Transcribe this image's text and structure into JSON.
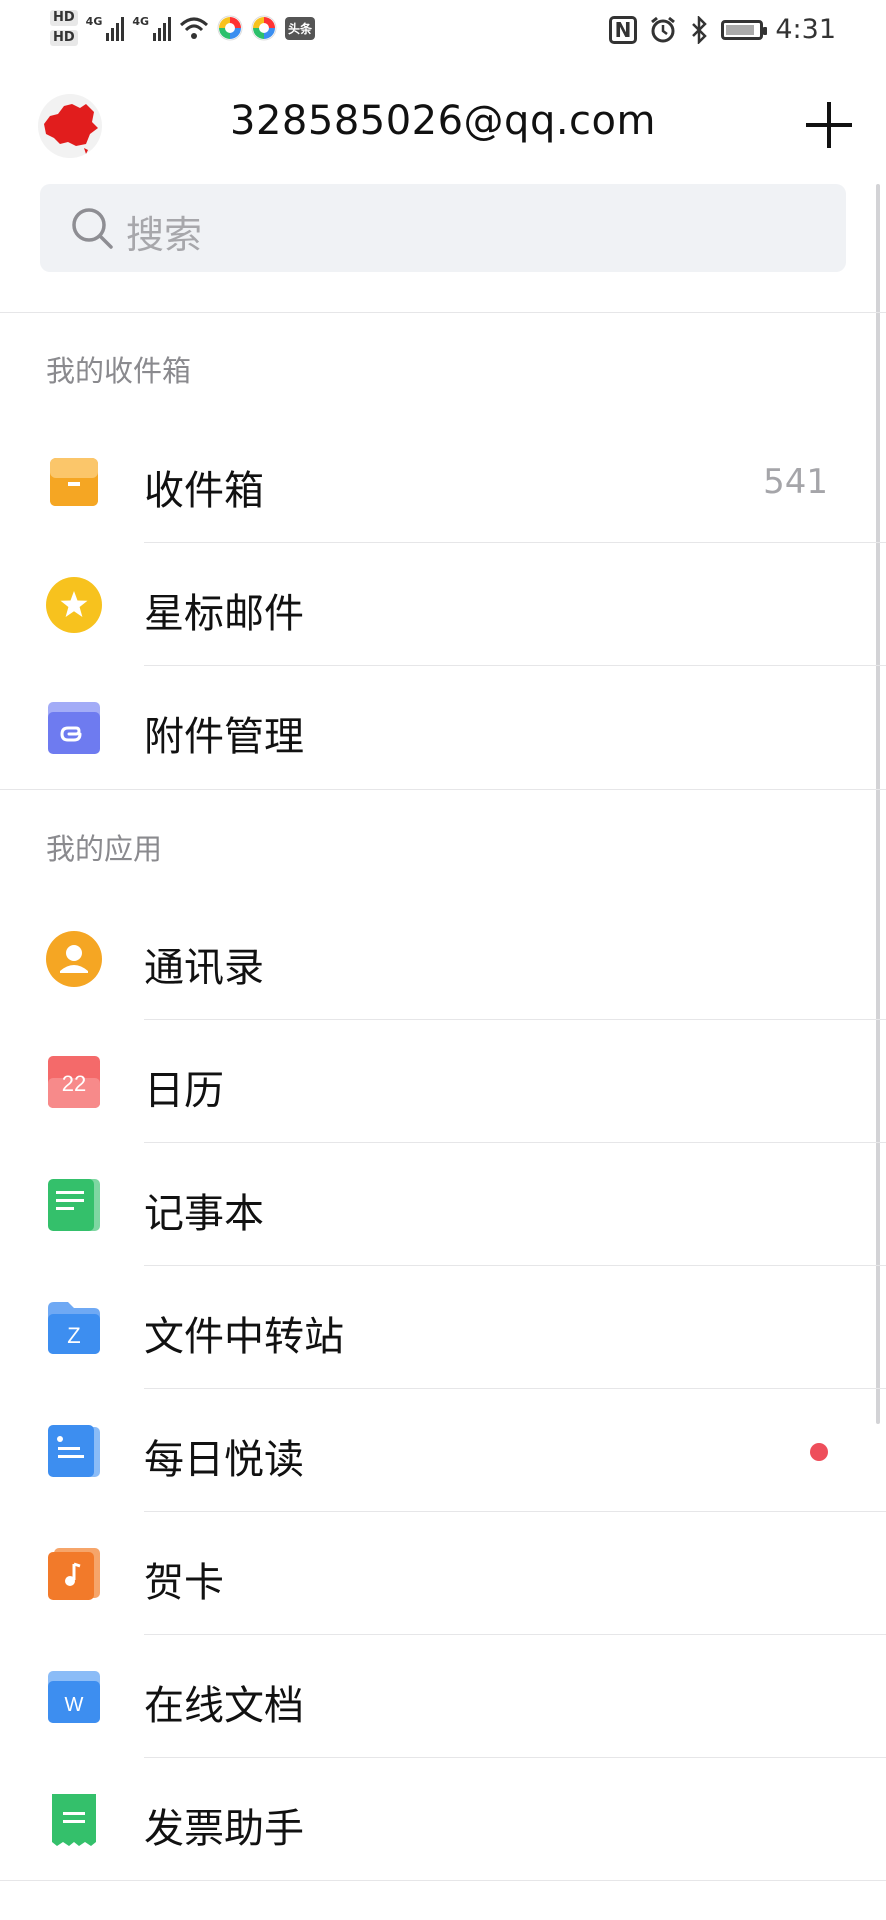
{
  "status_bar": {
    "hd1": "HD",
    "hd2": "HD",
    "net1": "4G",
    "net2": "4G",
    "toutiao": "头条",
    "nfc": "N",
    "alarm_icon": "alarm-icon",
    "bluetooth_icon": "bluetooth-icon",
    "battery_icon": "battery-charging-icon",
    "battery_level": 0.8,
    "time": "4:31"
  },
  "header": {
    "account": "328585026@qq.com",
    "avatar_icon": "china-map-avatar",
    "add_icon": "plus-icon"
  },
  "search": {
    "placeholder": "搜索",
    "icon": "search-icon"
  },
  "inbox_section": {
    "title": "我的收件箱",
    "items": [
      {
        "label": "收件箱",
        "count": "541",
        "icon": "inbox-tray-icon",
        "color": "#f5a623"
      },
      {
        "label": "星标邮件",
        "icon": "star-icon",
        "color": "#f7c21e"
      },
      {
        "label": "附件管理",
        "icon": "attachment-folder-icon",
        "color": "#6e7bf0"
      }
    ]
  },
  "apps_section": {
    "title": "我的应用",
    "items": [
      {
        "label": "通讯录",
        "icon": "contacts-icon",
        "color": "#f5a623"
      },
      {
        "label": "日历",
        "icon": "calendar-icon",
        "badge_text": "22",
        "color": "#f46a6a"
      },
      {
        "label": "记事本",
        "icon": "notepad-icon",
        "color": "#34c06b"
      },
      {
        "label": "文件中转站",
        "icon": "file-transfer-folder-icon",
        "badge_text": "Z",
        "color": "#3d8ef0"
      },
      {
        "label": "每日悦读",
        "icon": "daily-reading-icon",
        "color": "#3d8ef0",
        "has_unread_dot": true
      },
      {
        "label": "贺卡",
        "icon": "greeting-card-music-icon",
        "color": "#f27a2a"
      },
      {
        "label": "在线文档",
        "icon": "online-doc-icon",
        "badge_text": "W",
        "color": "#3d8ef0"
      },
      {
        "label": "发票助手",
        "icon": "invoice-icon",
        "color": "#34c06b"
      }
    ]
  },
  "colors": {
    "divider": "#e6e6e8",
    "section_text": "#8a8a8e",
    "unread_dot": "#ee4e5b",
    "search_bg": "#f0f2f5"
  }
}
